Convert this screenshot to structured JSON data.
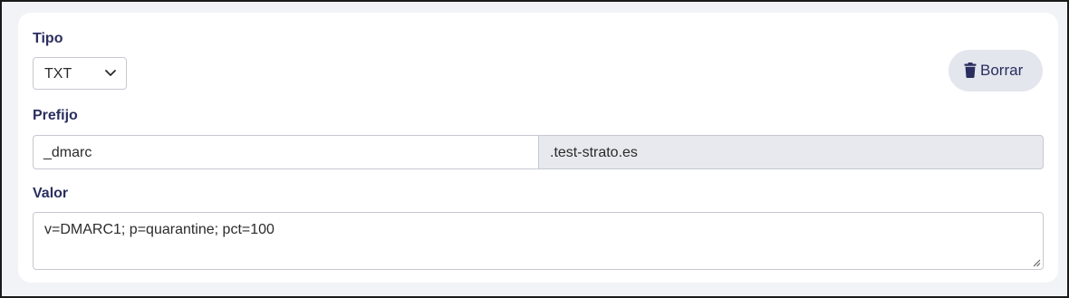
{
  "tipo": {
    "label": "Tipo",
    "selected": "TXT"
  },
  "delete_button": {
    "label": "Borrar",
    "icon": "trash-icon"
  },
  "prefijo": {
    "label": "Prefijo",
    "value": "_dmarc",
    "domain_suffix": ".test-strato.es"
  },
  "valor": {
    "label": "Valor",
    "value": "v=DMARC1; p=quarantine; pct=100"
  },
  "colors": {
    "label_text": "#2a2e5e",
    "button_bg": "#e4e6ee",
    "readonly_bg": "#e7e9ee"
  }
}
